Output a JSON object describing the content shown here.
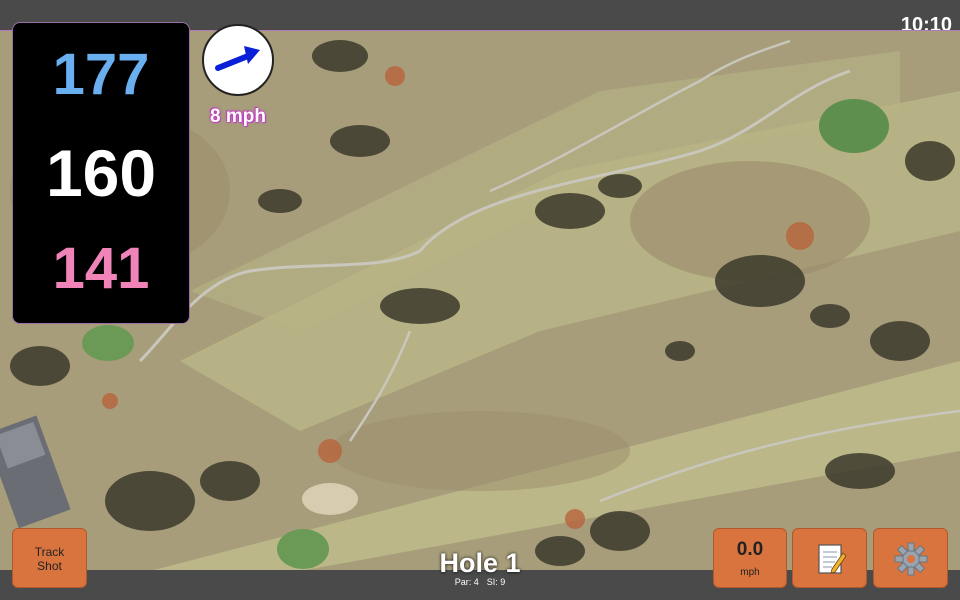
{
  "status": {
    "time": "10:10"
  },
  "distances": {
    "back": "177",
    "middle": "160",
    "front": "141"
  },
  "wind": {
    "speed": "8 mph",
    "direction_icon": "wind-arrow-icon"
  },
  "hole": {
    "title": "Hole 1",
    "par": "Par: 4",
    "stroke_index": "SI: 9"
  },
  "buttons": {
    "track_shot": "Track\nShot",
    "speed_value": "0.0",
    "speed_unit": "mph",
    "notes_icon": "notepad-icon",
    "settings_icon": "gear-icon",
    "color": "#d9743f"
  },
  "colors": {
    "back": "#6ab0f0",
    "middle": "#ffffff",
    "front": "#f084b8",
    "wind_label_glow": "#c040c0"
  }
}
